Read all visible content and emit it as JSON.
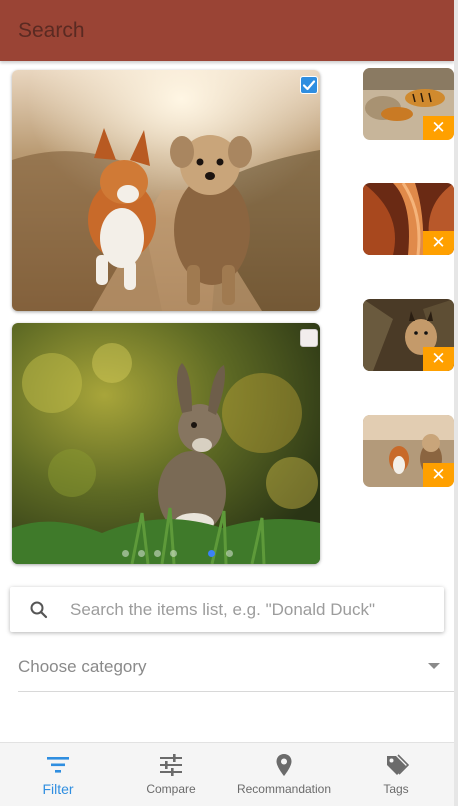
{
  "appbar": {
    "title": "Search"
  },
  "gallery": {
    "cards": [
      {
        "name": "dogs-running-photo",
        "selected": true
      },
      {
        "name": "rabbit-photo",
        "selected": false
      }
    ],
    "pagination": {
      "count": 6,
      "active_index": 4
    }
  },
  "selected_thumbnails": [
    {
      "name": "tiger-thumbnail",
      "remove_icon": "close-icon"
    },
    {
      "name": "canyon-thumbnail",
      "remove_icon": "close-icon"
    },
    {
      "name": "lynx-thumbnail",
      "remove_icon": "close-icon"
    },
    {
      "name": "dogs-thumbnail",
      "remove_icon": "close-icon"
    }
  ],
  "search": {
    "placeholder": "Search the items list, e.g. \"Donald Duck\"",
    "value": "",
    "icon": "search-icon"
  },
  "category": {
    "placeholder": "Choose category",
    "icon": "chevron-down-icon"
  },
  "bottom_nav": {
    "items": [
      {
        "label": "Filter",
        "icon": "filter-icon",
        "active": true
      },
      {
        "label": "Compare",
        "icon": "sliders-icon",
        "active": false
      },
      {
        "label": "Recommandation",
        "icon": "location-pin-icon",
        "active": false
      },
      {
        "label": "Tags",
        "icon": "tags-icon",
        "active": false
      }
    ]
  },
  "colors": {
    "appbar": "#9a4435",
    "accent": "#2f8ee0",
    "remove_badge": "#ffa000"
  }
}
